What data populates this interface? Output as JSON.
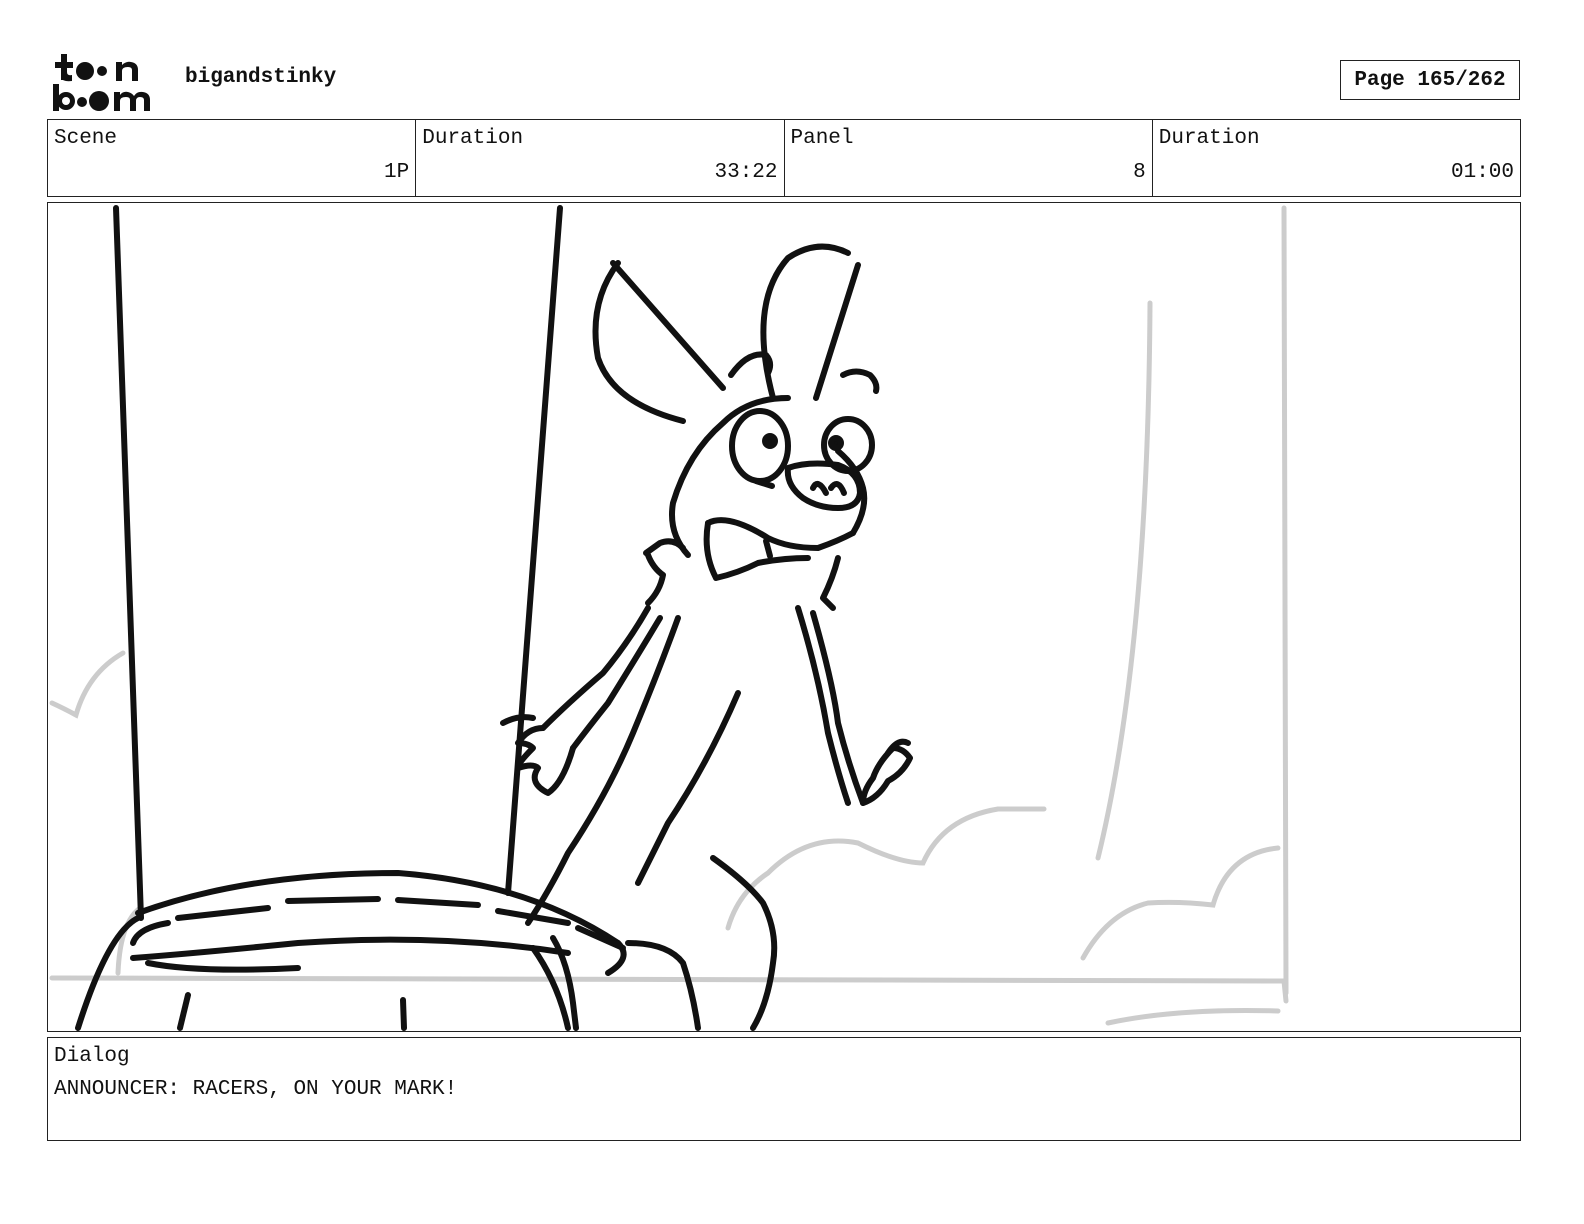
{
  "header": {
    "logo_icon": "toonboom-logo-icon",
    "logo_text": "toon boom",
    "project_name": "bigandstinky",
    "page_label": "Page 165/262"
  },
  "fields": {
    "scene": {
      "label": "Scene",
      "value": "1P"
    },
    "scene_duration": {
      "label": "Duration",
      "value": "33:22"
    },
    "panel": {
      "label": "Panel",
      "value": "8"
    },
    "panel_duration": {
      "label": "Duration",
      "value": "01:00"
    }
  },
  "dialog": {
    "label": "Dialog",
    "text": "ANNOUNCER: RACERS, ON YOUR MARK!"
  },
  "colors": {
    "ink": "#111111",
    "sketch_gray": "#cccccc",
    "border": "#222222"
  }
}
